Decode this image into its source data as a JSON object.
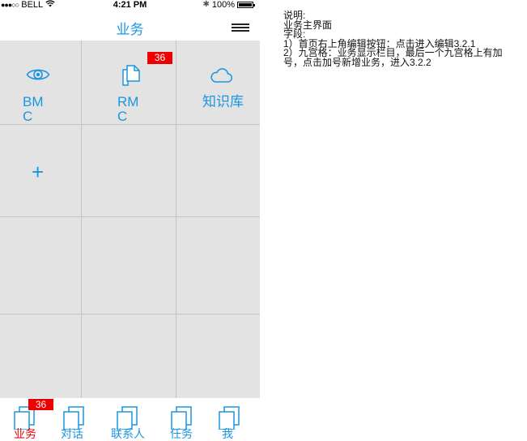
{
  "status_bar": {
    "signal": "●●●○○",
    "carrier": "BELL",
    "time": "4:21 PM",
    "bluetooth": "✱",
    "battery_percent": "100%"
  },
  "nav": {
    "title": "业务",
    "menu_icon": "menu-icon"
  },
  "grid": {
    "cells": [
      {
        "label": "BMC",
        "icon": "eye-icon"
      },
      {
        "label": "RMC",
        "icon": "document-icon",
        "badge": "36"
      },
      {
        "label": "知识库",
        "icon": "cloud-icon"
      },
      {
        "label": "+",
        "icon": "plus-icon"
      }
    ]
  },
  "tab_bar": {
    "tabs": [
      {
        "label": "业务",
        "badge": "36",
        "active": true,
        "icon": "tab-document-icon"
      },
      {
        "label": "对话",
        "icon": "tab-document-icon"
      },
      {
        "label": "联系人",
        "icon": "tab-document-icon"
      },
      {
        "label": "任务",
        "icon": "tab-document-icon"
      },
      {
        "label": "我",
        "icon": "tab-document-icon"
      }
    ]
  },
  "colors": {
    "accent": "#1a96e0",
    "badge": "#ee0000",
    "grid_bg": "#e3e3e3",
    "grid_line": "#c4c4c4"
  },
  "notes": {
    "lines": [
      "说明:",
      "业务主界面",
      "字段:",
      "1）首页右上角编辑按钮：点击进入编辑3.2.1",
      "2）九宫格：业务显示栏目，最后一个九宫格上有加",
      "号，点击加号新增业务，进入3.2.2"
    ]
  }
}
